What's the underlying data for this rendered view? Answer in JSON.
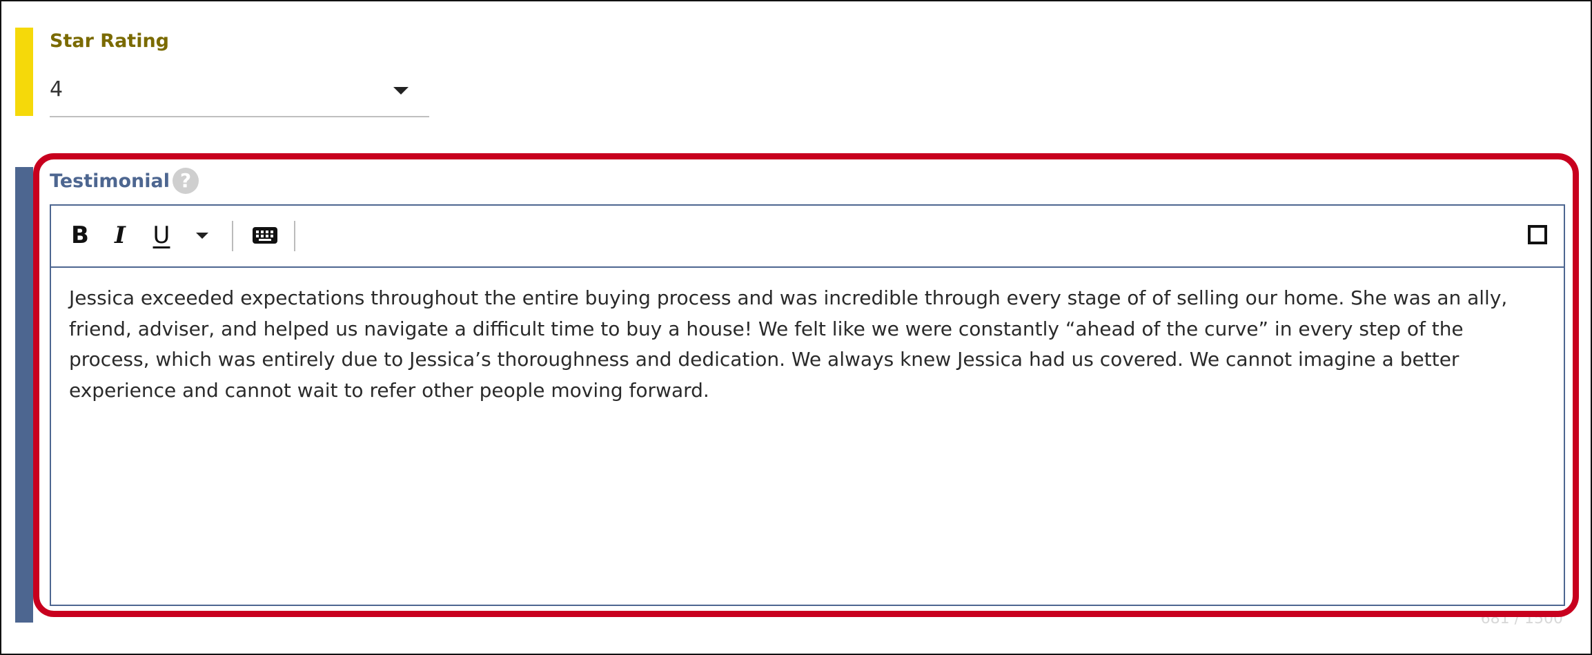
{
  "star_rating": {
    "label": "Star Rating",
    "selected": "4"
  },
  "testimonial": {
    "label": "Testimonial",
    "help_glyph": "?",
    "toolbar": {
      "bold_label": "B",
      "italic_label": "I",
      "underline_label": "U"
    },
    "body": "Jessica exceeded expectations throughout the entire buying process and was incredible through every stage of of selling our home. She was an ally, friend, adviser, and helped us navigate a difficult time to buy a house! We felt like we were constantly “ahead of the curve” in every step of the process, which was entirely due to Jessica’s thoroughness and dedication. We always knew Jessica had us covered. We cannot imagine a better experience and cannot wait to refer other people moving forward.",
    "char_count": "681 / 1500"
  },
  "colors": {
    "star_accent": "#f5d90a",
    "testimonial_accent": "#4d6690",
    "highlight_border": "#c8001e"
  },
  "icons": [
    "chevron-down-icon",
    "help-icon",
    "bold-icon",
    "italic-icon",
    "underline-icon",
    "more-options-icon",
    "keyboard-icon",
    "fullscreen-icon"
  ]
}
